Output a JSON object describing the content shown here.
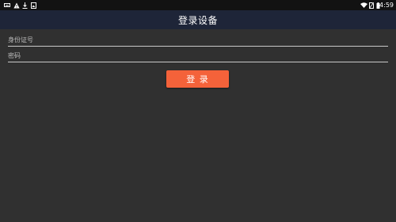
{
  "status_bar": {
    "time": "4:59",
    "left_icons": [
      "keyboard-icon",
      "warning-icon",
      "download-icon",
      "photo-icon"
    ],
    "right_icons": [
      "wifi-icon",
      "no-sim-icon",
      "battery-icon"
    ]
  },
  "app_bar": {
    "title": "登录设备",
    "background": "#1e2538"
  },
  "form": {
    "id_field": {
      "placeholder": "身份证号",
      "value": ""
    },
    "password_field": {
      "placeholder": "密码",
      "value": ""
    },
    "login_button": {
      "label": "登 录",
      "color": "#f4623a"
    }
  }
}
